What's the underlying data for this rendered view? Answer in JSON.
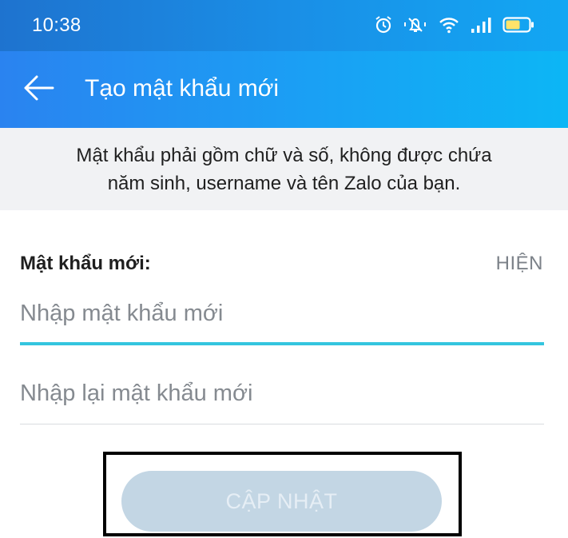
{
  "status_bar": {
    "time": "10:38",
    "icons": [
      "alarm-icon",
      "mute-icon",
      "wifi-icon",
      "signal-icon",
      "battery-icon"
    ],
    "battery_color": "#ffe36a"
  },
  "app_bar": {
    "back_icon": "arrow-left-icon",
    "title": "Tạo mật khẩu mới"
  },
  "info": {
    "line1": "Mật khẩu phải gồm chữ và số, không được chứa",
    "line2": "năm sinh, username và tên Zalo của bạn."
  },
  "form": {
    "new_password_label": "Mật khẩu mới:",
    "show_toggle": "HIỆN",
    "new_password_placeholder": "Nhập mật khẩu mới",
    "new_password_value": "",
    "confirm_password_placeholder": "Nhập lại mật khẩu mới",
    "confirm_password_value": ""
  },
  "actions": {
    "update_label": "CẬP NHẬT"
  },
  "colors": {
    "accent": "#34c5df",
    "button_disabled": "#c3d6e4",
    "header_blue": "#1aa0f4"
  }
}
